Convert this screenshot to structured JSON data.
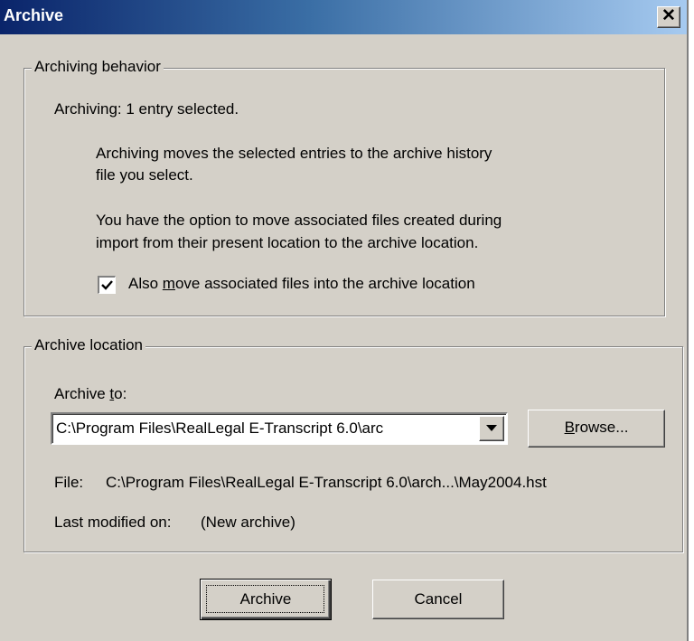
{
  "window": {
    "title": "Archive",
    "close_symbol": "✕"
  },
  "behavior_group": {
    "legend": "Archiving behavior",
    "status": "Archiving:  1 entry selected.",
    "desc1_line1": "Archiving moves the selected entries to the archive history",
    "desc1_line2": "file you select.",
    "desc2_line1": "You have the option to move associated files created during",
    "desc2_line2": "import from their present location to the archive location.",
    "checkbox": {
      "checked": true,
      "label_pre": "Also ",
      "label_accel": "m",
      "label_post": "ove associated files into the archive location"
    }
  },
  "location_group": {
    "legend": "Archive location",
    "archive_to_pre": "Archive ",
    "archive_to_accel": "t",
    "archive_to_post": "o:",
    "path_value": "C:\\Program Files\\RealLegal E-Transcript 6.0\\arc",
    "browse_accel": "B",
    "browse_rest": "rowse...",
    "file_label": "File:",
    "file_value": "C:\\Program Files\\RealLegal E-Transcript 6.0\\arch...\\May2004.hst",
    "modified_label": "Last modified on:",
    "modified_value": "(New archive)"
  },
  "buttons": {
    "archive": "Archive",
    "cancel": "Cancel"
  }
}
